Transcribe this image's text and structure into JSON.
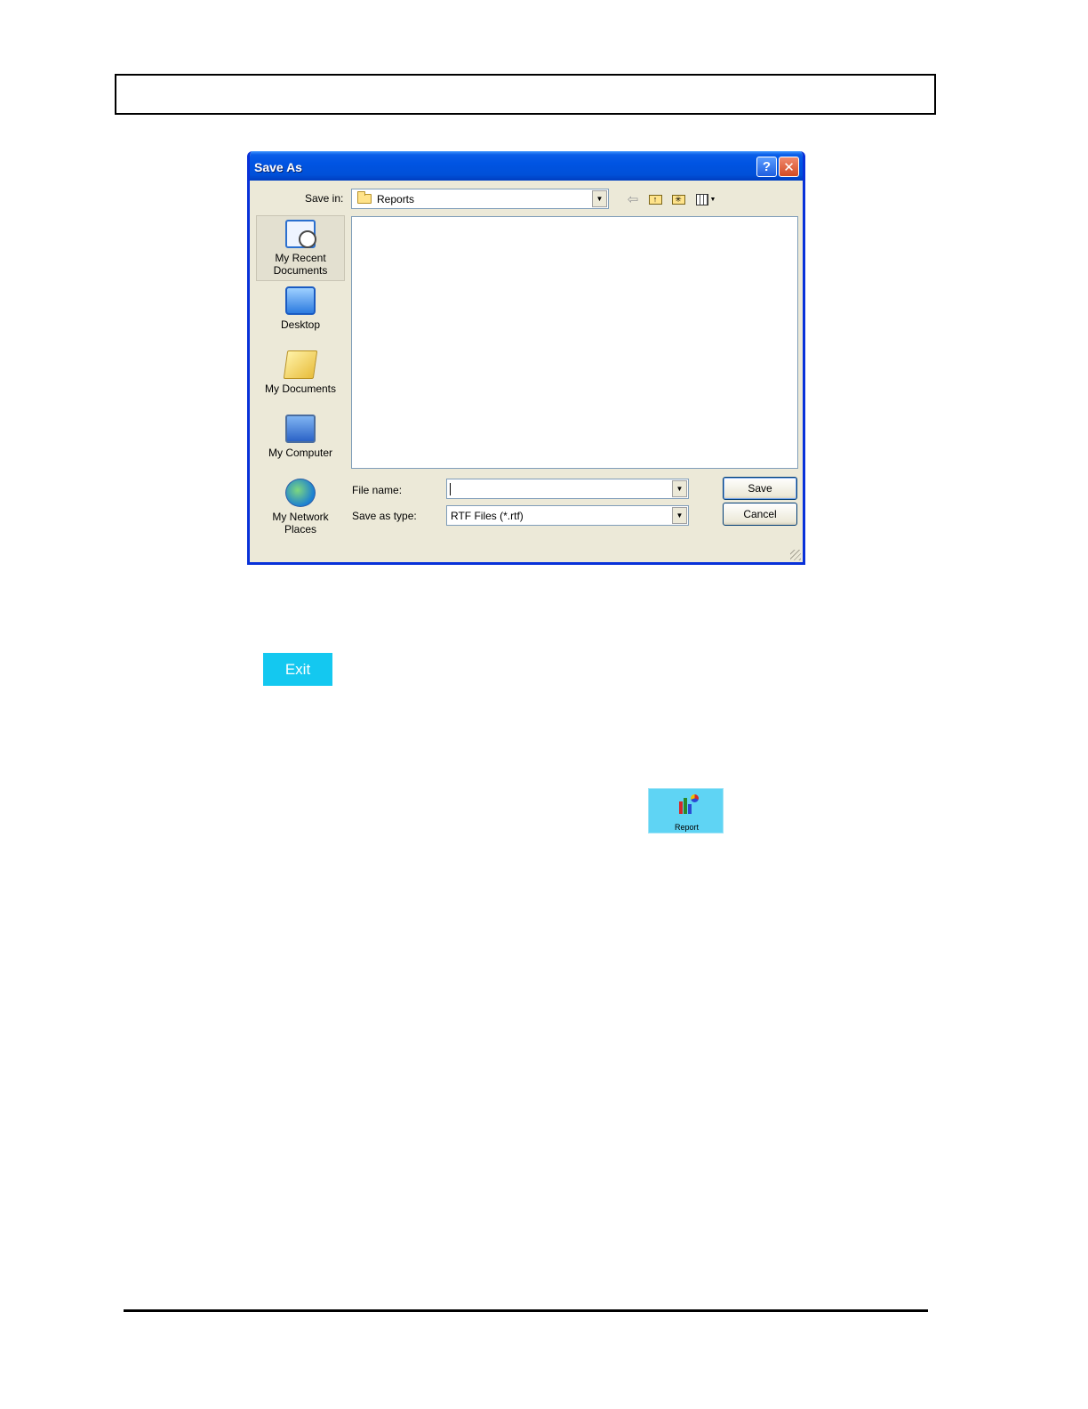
{
  "header_box": "",
  "dialog": {
    "title": "Save As",
    "help_glyph": "?",
    "close_glyph": "✕",
    "save_in_label": "Save in:",
    "save_in_value": "Reports",
    "places": [
      {
        "label": "My Recent Documents",
        "icon": "recent-documents-icon"
      },
      {
        "label": "Desktop",
        "icon": "desktop-icon"
      },
      {
        "label": "My Documents",
        "icon": "my-documents-icon"
      },
      {
        "label": "My Computer",
        "icon": "my-computer-icon"
      },
      {
        "label": "My Network Places",
        "icon": "network-places-icon"
      }
    ],
    "file_name_label": "File name:",
    "file_name_value": "",
    "save_as_type_label": "Save as type:",
    "save_as_type_value": "RTF Files (*.rtf)",
    "save_button": "Save",
    "cancel_button": "Cancel"
  },
  "exit_button": {
    "label": "Exit",
    "color": "#14c8f0"
  },
  "report_button": {
    "label": "Report",
    "color": "#5fd4f4"
  },
  "colors": {
    "titlebar": "#0054e3",
    "dialog_bg": "#ece9d8"
  }
}
